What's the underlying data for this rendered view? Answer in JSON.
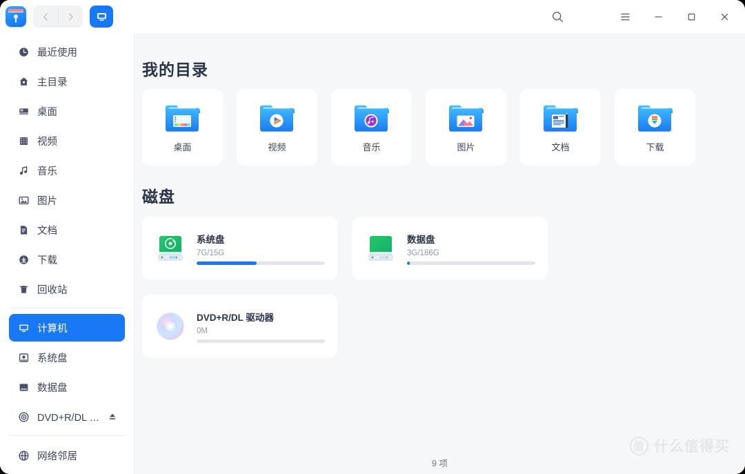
{
  "window": {
    "app_icon": "file-manager-icon",
    "nav_back": "back-icon",
    "nav_forward": "forward-icon",
    "view_mode_button": "computer-view-icon",
    "search": "search-icon",
    "menu": "hamburger-menu-icon",
    "minimize": "minimize-icon",
    "maximize": "maximize-icon",
    "close": "close-icon",
    "accent_color": "#1878f5"
  },
  "sidebar": {
    "items": [
      {
        "label": "最近使用",
        "icon": "clock-icon",
        "selected": false
      },
      {
        "label": "主目录",
        "icon": "home-icon",
        "selected": false
      },
      {
        "label": "桌面",
        "icon": "desktop-icon",
        "selected": false
      },
      {
        "label": "视频",
        "icon": "video-icon",
        "selected": false
      },
      {
        "label": "音乐",
        "icon": "music-note-icon",
        "selected": false
      },
      {
        "label": "图片",
        "icon": "image-icon",
        "selected": false
      },
      {
        "label": "文档",
        "icon": "document-icon",
        "selected": false
      },
      {
        "label": "下载",
        "icon": "download-icon",
        "selected": false
      },
      {
        "label": "回收站",
        "icon": "trash-icon",
        "selected": false
      },
      {
        "label": "计算机",
        "icon": "computer-icon",
        "selected": true
      },
      {
        "label": "系统盘",
        "icon": "system-disk-icon",
        "selected": false
      },
      {
        "label": "数据盘",
        "icon": "data-disk-icon",
        "selected": false
      },
      {
        "label": "DVD+R/DL 驱…",
        "icon": "optical-disc-icon",
        "selected": false,
        "eject": "eject-icon"
      },
      {
        "label": "网络邻居",
        "icon": "network-icon",
        "selected": false
      }
    ]
  },
  "main": {
    "directories_title": "我的目录",
    "directories": [
      {
        "label": "桌面",
        "icon": "folder-desktop-icon"
      },
      {
        "label": "视频",
        "icon": "folder-videos-icon"
      },
      {
        "label": "音乐",
        "icon": "folder-music-icon"
      },
      {
        "label": "图片",
        "icon": "folder-pictures-icon"
      },
      {
        "label": "文档",
        "icon": "folder-documents-icon"
      },
      {
        "label": "下载",
        "icon": "folder-downloads-icon"
      }
    ],
    "disks_title": "磁盘",
    "disks": [
      {
        "name": "系统盘",
        "size": "7G/15G",
        "percent": 47,
        "icon": "hdd-green-icon"
      },
      {
        "name": "数据盘",
        "size": "3G/186G",
        "percent": 2,
        "icon": "hdd-green-icon"
      },
      {
        "name": "DVD+R/DL 驱动器",
        "size": "0M",
        "percent": 0,
        "icon": "optical-disc-icon"
      }
    ]
  },
  "status": {
    "count_label": "9 项"
  },
  "watermark": {
    "badge": "值",
    "text": "什么值得买"
  }
}
